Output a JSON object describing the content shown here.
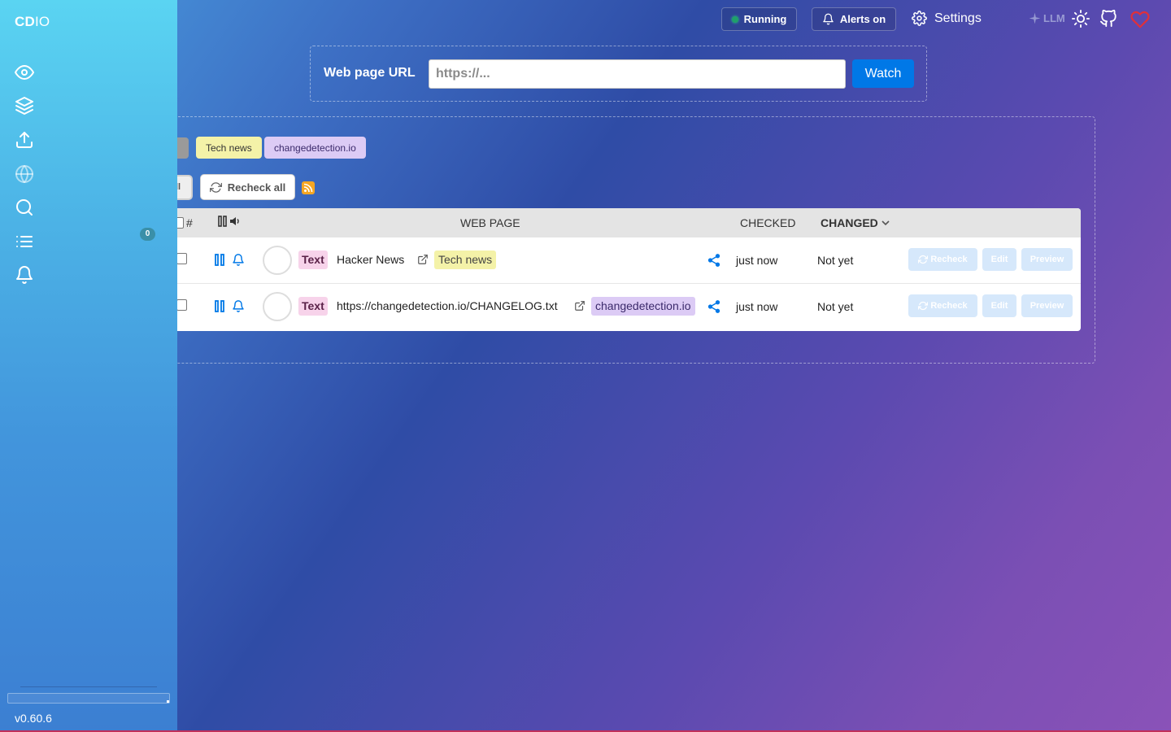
{
  "app": {
    "brand_bold": "CD",
    "brand_rest": "IO",
    "version": "v0.60.6"
  },
  "sidebar": {
    "items": [
      {
        "icon": "eye-icon"
      },
      {
        "icon": "layers-icon"
      },
      {
        "icon": "upload-icon"
      },
      {
        "icon": "globe-icon"
      },
      {
        "icon": "search-icon"
      },
      {
        "icon": "list-icon",
        "badge": "0"
      },
      {
        "icon": "bell-icon"
      }
    ]
  },
  "topbar": {
    "status_label": "Running",
    "alerts_label": "Alerts on",
    "settings_label": "Settings",
    "llm_label": "LLM"
  },
  "add_watch": {
    "label": "Web page URL",
    "placeholder": "https://...",
    "button_label": "Watch"
  },
  "tags": [
    {
      "label": "Tech news",
      "color": "#f4f2a8"
    },
    {
      "label": "changedetection.io",
      "color": "#dccbf5"
    }
  ],
  "toolbar": {
    "clipped_label": "ll",
    "recheck_all_label": "Recheck all"
  },
  "table": {
    "headers": {
      "hash": "#",
      "web_page": "WEB PAGE",
      "checked": "CHECKED",
      "changed": "CHANGED"
    },
    "rows": [
      {
        "type": "Text",
        "title": "Hacker News",
        "tag": "Tech news",
        "checked": "just now",
        "changed": "Not yet",
        "actions": {
          "recheck": "Recheck",
          "edit": "Edit",
          "preview": "Preview"
        }
      },
      {
        "type": "Text",
        "title": "https://changedetection.io/CHANGELOG.txt",
        "tag": "changedetection.io",
        "checked": "just now",
        "changed": "Not yet",
        "actions": {
          "recheck": "Recheck",
          "edit": "Edit",
          "preview": "Preview"
        }
      }
    ]
  },
  "colors": {
    "accent": "#0078e7",
    "status_running": "#1fa06a",
    "heart": "#e0303a"
  }
}
